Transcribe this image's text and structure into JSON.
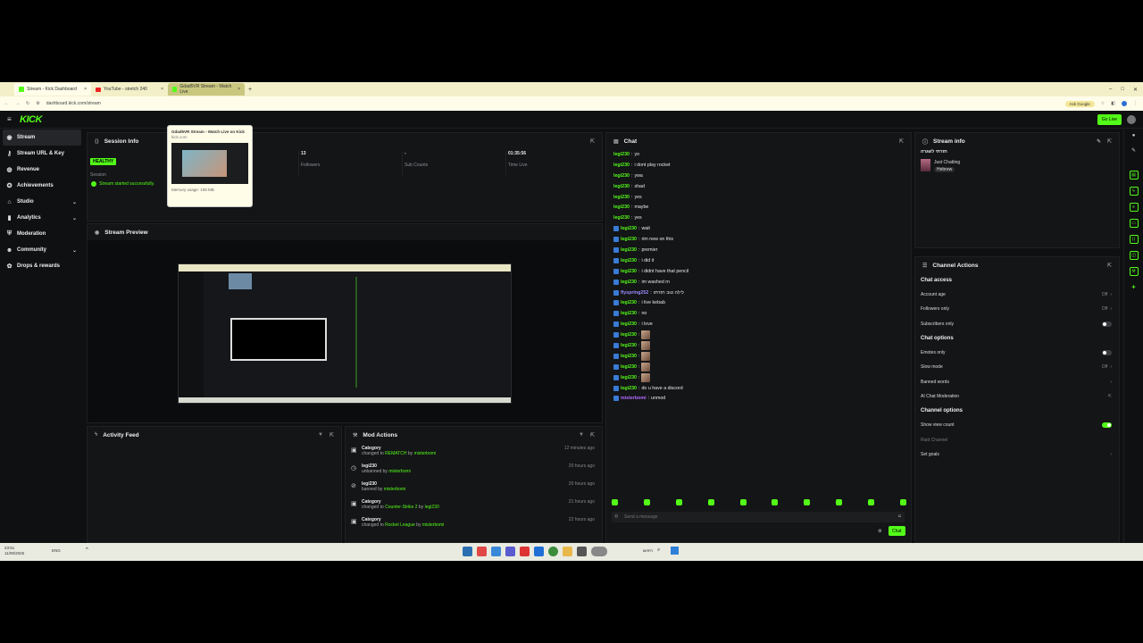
{
  "browser": {
    "tabs": [
      {
        "label": "Stream - Kick Dashboard",
        "icon": "kick-icon"
      },
      {
        "label": "YouTube - stretch 240",
        "icon": "youtube-icon"
      },
      {
        "label": "Gdad5VR Stream - Watch Live",
        "icon": "kick-icon"
      }
    ],
    "new_tab": "+",
    "url": "dashboard.kick.com/stream",
    "ask_google": "Ask Google",
    "window_controls": [
      "–",
      "□",
      "✕"
    ]
  },
  "tab_preview": {
    "title": "Gdad5VR Stream - Watch Live on Kick",
    "domain": "kick.com",
    "memory": "Memory usage: 108 MB"
  },
  "topnav": {
    "logo": "KICK",
    "go_live": "Go Live"
  },
  "sidebar": {
    "items": [
      {
        "label": "Stream",
        "icon": "broadcast-icon",
        "active": true,
        "chevron": ""
      },
      {
        "label": "Stream URL & Key",
        "icon": "key-icon",
        "chevron": ""
      },
      {
        "label": "Revenue",
        "icon": "coin-icon",
        "chevron": ""
      },
      {
        "label": "Achievements",
        "icon": "trophy-icon",
        "chevron": ""
      },
      {
        "label": "Studio",
        "icon": "studio-icon",
        "chevron": "⌄"
      },
      {
        "label": "Analytics",
        "icon": "chart-icon",
        "chevron": "⌄"
      },
      {
        "label": "Moderation",
        "icon": "shield-icon",
        "chevron": ""
      },
      {
        "label": "Community",
        "icon": "people-icon",
        "chevron": "⌄"
      },
      {
        "label": "Drops & rewards",
        "icon": "gift-icon",
        "chevron": ""
      }
    ]
  },
  "session_info": {
    "title": "Session Info",
    "health_badge": "HEALTHY",
    "health_label": "Session",
    "stats": [
      {
        "value": "13",
        "label": "Followers"
      },
      {
        "value": "-",
        "label": "Sub Counts"
      },
      {
        "value": "01:35:56",
        "label": "Time Live"
      }
    ],
    "status_message": "Stream started successfully."
  },
  "stream_preview": {
    "title": "Stream Preview"
  },
  "activity_feed": {
    "title": "Activity Feed"
  },
  "mod_actions": {
    "title": "Mod Actions",
    "items": [
      {
        "title": "Category",
        "pre": "changed to ",
        "target": "REMATCH",
        "mid": " by ",
        "actor": "misterbomi",
        "time": "12 minutes ago",
        "icon": "lock-icon"
      },
      {
        "title": "legi230",
        "pre": "unbanned by ",
        "target": "",
        "mid": "",
        "actor": "misterbomi",
        "time": "20 hours ago",
        "icon": "clock-icon"
      },
      {
        "title": "legi230",
        "pre": "banned by ",
        "target": "",
        "mid": "",
        "actor": "misterbomi",
        "time": "20 hours ago",
        "icon": "ban-icon"
      },
      {
        "title": "Category",
        "pre": "changed to ",
        "target": "Counter-Strike 2",
        "mid": " by ",
        "actor": "legi230",
        "time": "21 hours ago",
        "icon": "lock-icon"
      },
      {
        "title": "Category",
        "pre": "changed to ",
        "target": "Rocket League",
        "mid": " by ",
        "actor": "misterbomi",
        "time": "22 hours ago",
        "icon": "lock-icon"
      }
    ]
  },
  "chat": {
    "title": "Chat",
    "placeholder": "Send a message",
    "send_label": "Chat",
    "messages": [
      {
        "user": "legi230",
        "text": "yo",
        "badge": false,
        "emote": false
      },
      {
        "user": "legi230",
        "text": "i dont play rocket",
        "badge": false,
        "emote": false
      },
      {
        "user": "legi230",
        "text": "ywa",
        "badge": false,
        "emote": false
      },
      {
        "user": "legi230",
        "text": "shad",
        "badge": false,
        "emote": false
      },
      {
        "user": "legi230",
        "text": "yes",
        "badge": false,
        "emote": false
      },
      {
        "user": "legi230",
        "text": "maybe",
        "badge": false,
        "emote": false
      },
      {
        "user": "legi230",
        "text": "yes",
        "badge": false,
        "emote": false
      },
      {
        "user": "legi230",
        "text": "wait",
        "badge": true,
        "emote": false
      },
      {
        "user": "legi230",
        "text": "rim new on this",
        "badge": true,
        "emote": false
      },
      {
        "user": "legi230",
        "text": "premier",
        "badge": true,
        "emote": false
      },
      {
        "user": "legi230",
        "text": "i did it",
        "badge": true,
        "emote": false
      },
      {
        "user": "legi230",
        "text": "i didnt have that pencil",
        "badge": true,
        "emote": false
      },
      {
        "user": "legi230",
        "text": "im washed rn",
        "badge": true,
        "emote": false
      },
      {
        "user": "flyspring252",
        "text": "לילה טוב חזרתו",
        "badge": true,
        "emote": false
      },
      {
        "user": "legi230",
        "text": "i live kebab",
        "badge": true,
        "emote": false
      },
      {
        "user": "legi230",
        "text": "no",
        "badge": true,
        "emote": false
      },
      {
        "user": "legi230",
        "text": "i love",
        "badge": true,
        "emote": false
      },
      {
        "user": "legi230",
        "text": "",
        "badge": true,
        "emote": true
      },
      {
        "user": "legi230",
        "text": "",
        "badge": true,
        "emote": true
      },
      {
        "user": "legi230",
        "text": "",
        "badge": true,
        "emote": true
      },
      {
        "user": "legi230",
        "text": "",
        "badge": true,
        "emote": true
      },
      {
        "user": "legi230",
        "text": "",
        "badge": true,
        "emote": true
      },
      {
        "user": "legi230",
        "text": "do u have a discord",
        "badge": true,
        "emote": false
      },
      {
        "user": "misterbomi",
        "text": "unmod",
        "badge": true,
        "emote": false
      }
    ],
    "emote_count": 10
  },
  "stream_info": {
    "title": "Stream info",
    "stream_title": "חזרתי לשגרה",
    "category": "Just Chatting",
    "tag": "Hebrew"
  },
  "channel_actions": {
    "title": "Channel Actions",
    "sections": [
      {
        "heading": "Chat access",
        "rows": [
          {
            "label": "Account age",
            "value": "Off",
            "control": "chevron"
          },
          {
            "label": "Followers only",
            "value": "Off",
            "control": "chevron"
          },
          {
            "label": "Subscribers only",
            "value": "",
            "control": "toggle-off"
          }
        ]
      },
      {
        "heading": "Chat options",
        "rows": [
          {
            "label": "Emotes only",
            "value": "",
            "control": "toggle-off"
          },
          {
            "label": "Slow mode",
            "value": "Off",
            "control": "chevron"
          },
          {
            "label": "Banned words",
            "value": "",
            "control": "chevron"
          },
          {
            "label": "AI Chat Moderation",
            "value": "",
            "control": "external"
          }
        ]
      },
      {
        "heading": "Channel options",
        "rows": [
          {
            "label": "Show view count",
            "value": "",
            "control": "toggle-on"
          },
          {
            "label": "Raid Channel",
            "value": "",
            "control": "none"
          },
          {
            "label": "Set goals",
            "value": "",
            "control": "chevron"
          }
        ]
      }
    ]
  },
  "taskbar": {
    "time": "23:51",
    "date": "11/08/2026",
    "lang": "ENG",
    "search": "חיפוש"
  },
  "colors": {
    "accent": "#53fc18",
    "bg": "#0f1011",
    "panel": "#141517"
  }
}
